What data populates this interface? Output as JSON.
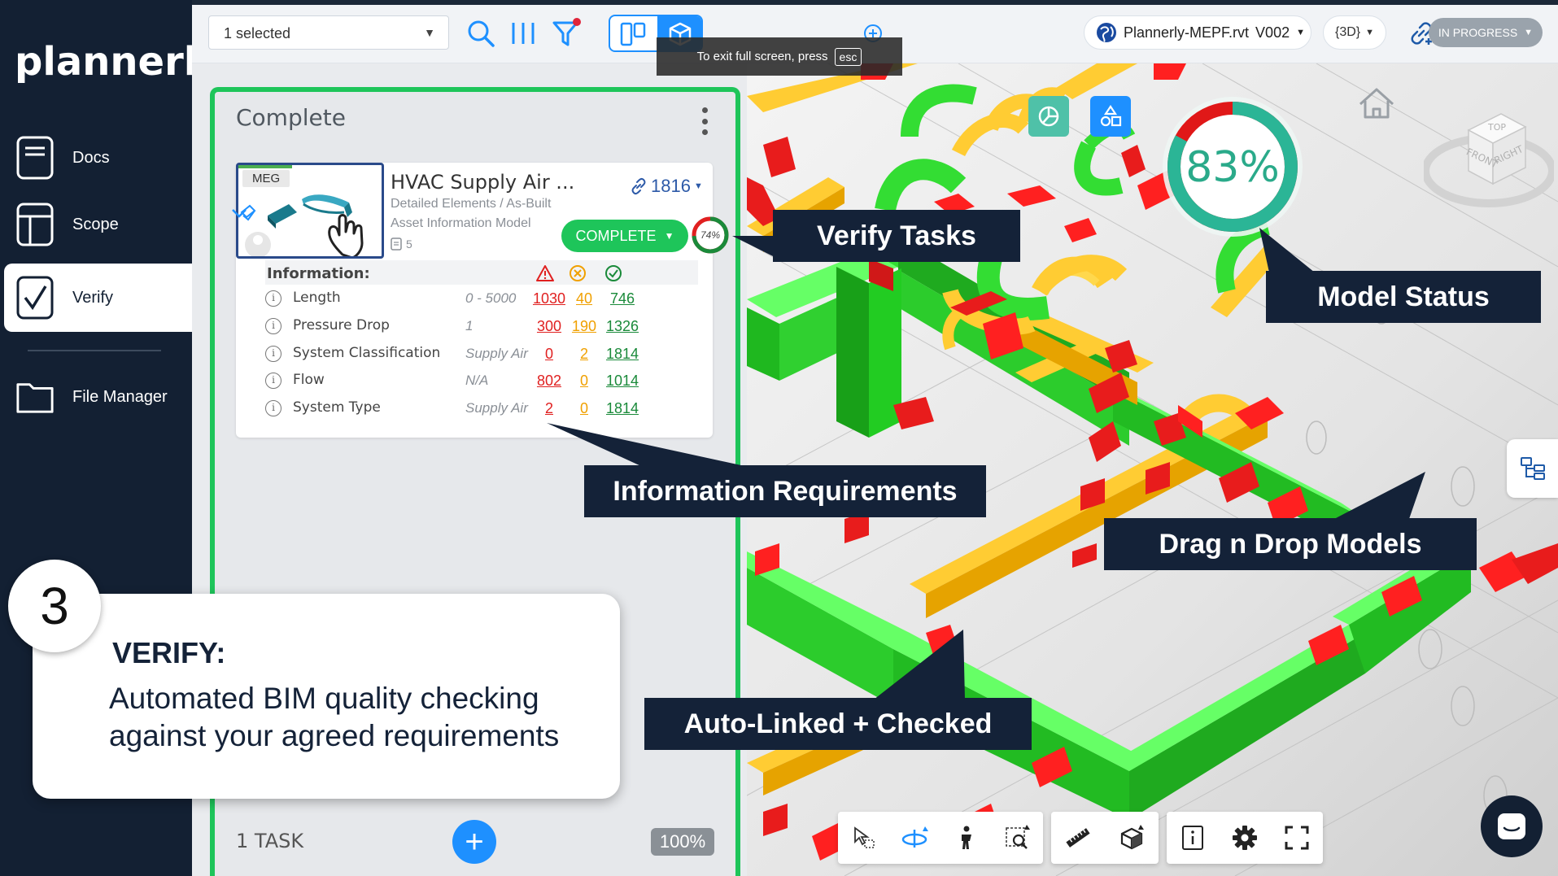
{
  "app": {
    "logo": "plannerly"
  },
  "sidebar": {
    "items": [
      {
        "label": "Docs",
        "icon": "document-icon"
      },
      {
        "label": "Scope",
        "icon": "layout-icon"
      },
      {
        "label": "Verify",
        "icon": "checkbox-icon",
        "active": true
      },
      {
        "label": "File Manager",
        "icon": "folder-icon"
      }
    ]
  },
  "toolbar": {
    "selection": "1 selected",
    "fullscreen_toast": "To exit full screen, press",
    "fullscreen_key": "esc",
    "model_name": "Plannerly-MEPF.rvt",
    "model_version": "V002",
    "view_mode": "{3D}",
    "status": "IN PROGRESS"
  },
  "column": {
    "title": "Complete",
    "task_count": "1 TASK",
    "add_label": "+",
    "progress": "100%"
  },
  "task": {
    "tag": "MEG",
    "title": "HVAC Supply Air ...",
    "subtitle1": "Detailed Elements / As-Built",
    "subtitle2": "Asset Information Model",
    "item_count": "5",
    "link_count": "1816",
    "status_button": "COMPLETE",
    "score": "74%",
    "score_value": 0.74,
    "info_title": "Information:",
    "rows": [
      {
        "label": "Length",
        "range": "0 - 5000",
        "errors": "1030",
        "warnings": "40",
        "ok": "746"
      },
      {
        "label": "Pressure Drop",
        "range": "1",
        "errors": "300",
        "warnings": "190",
        "ok": "1326"
      },
      {
        "label": "System Classification",
        "range": "Supply Air",
        "errors": "0",
        "warnings": "2",
        "ok": "1814"
      },
      {
        "label": "Flow",
        "range": "N/A",
        "errors": "802",
        "warnings": "0",
        "ok": "1014"
      },
      {
        "label": "System Type",
        "range": "Supply Air",
        "errors": "2",
        "warnings": "0",
        "ok": "1814"
      }
    ]
  },
  "model_status": {
    "percent": "83%",
    "value": 0.83
  },
  "viewcube": {
    "top": "TOP",
    "front": "FRONT",
    "right": "RIGHT"
  },
  "callouts": {
    "verify_tasks": "Verify Tasks",
    "model_status": "Model Status",
    "info_requirements": "Information Requirements",
    "drag_drop": "Drag n Drop Models",
    "auto_linked": "Auto-Linked + Checked"
  },
  "step": {
    "number": "3",
    "title": "VERIFY:",
    "line1": "Automated BIM quality checking",
    "line2": "against your agreed requirements"
  },
  "colors": {
    "navy": "#132033",
    "accent_green": "#1ec55a",
    "accent_blue": "#1e90ff",
    "error_red": "#e02020",
    "warning_orange": "#f0a000",
    "ok_green": "#1a8a3a"
  }
}
